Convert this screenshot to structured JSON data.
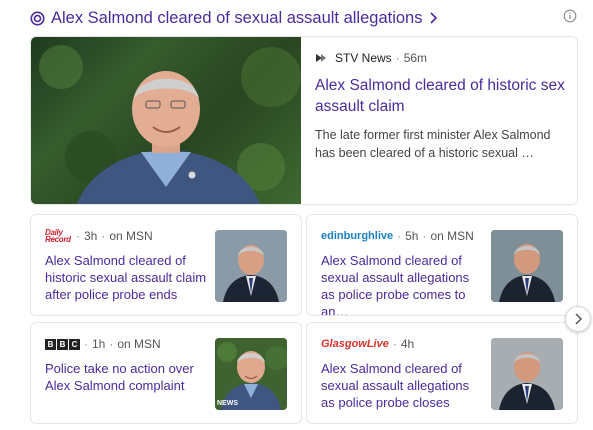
{
  "cluster": {
    "title": "Alex Salmond cleared of sexual assault allegations"
  },
  "main_story": {
    "source": "STV News",
    "age": "56m",
    "headline": "Alex Salmond cleared of historic sex assault claim",
    "snippet": "The late former first minister Alex Salmond has been cleared of a historic sexual …"
  },
  "stories": [
    {
      "logo": "Daily Record",
      "logo_lines": [
        "Daily",
        "Record"
      ],
      "age": "3h",
      "via": "on MSN",
      "headline": "Alex Salmond cleared of historic sexual assault claim after police probe ends"
    },
    {
      "logo": "edinburghlive",
      "age": "5h",
      "via": "on MSN",
      "headline": "Alex Salmond cleared of sexual assault allegations as police probe comes to an…"
    },
    {
      "logo": "BBC",
      "logo_letters": [
        "B",
        "B",
        "C"
      ],
      "age": "1h",
      "via": "on MSN",
      "headline": "Police take no action over Alex Salmond complaint",
      "thumb_caption": "NEWS"
    },
    {
      "logo": "GlasgowLive",
      "age": "4h",
      "headline": "Alex Salmond cleared of sexual assault allegations as police probe closes"
    }
  ],
  "colors": {
    "headline": "#4b2a9b",
    "meta": "#555555",
    "border": "#e6e6e6"
  },
  "icons": {
    "cluster": "news-cluster-icon",
    "info": "info-icon",
    "next": "chevron-right-icon",
    "source": "stv-logo-icon"
  }
}
